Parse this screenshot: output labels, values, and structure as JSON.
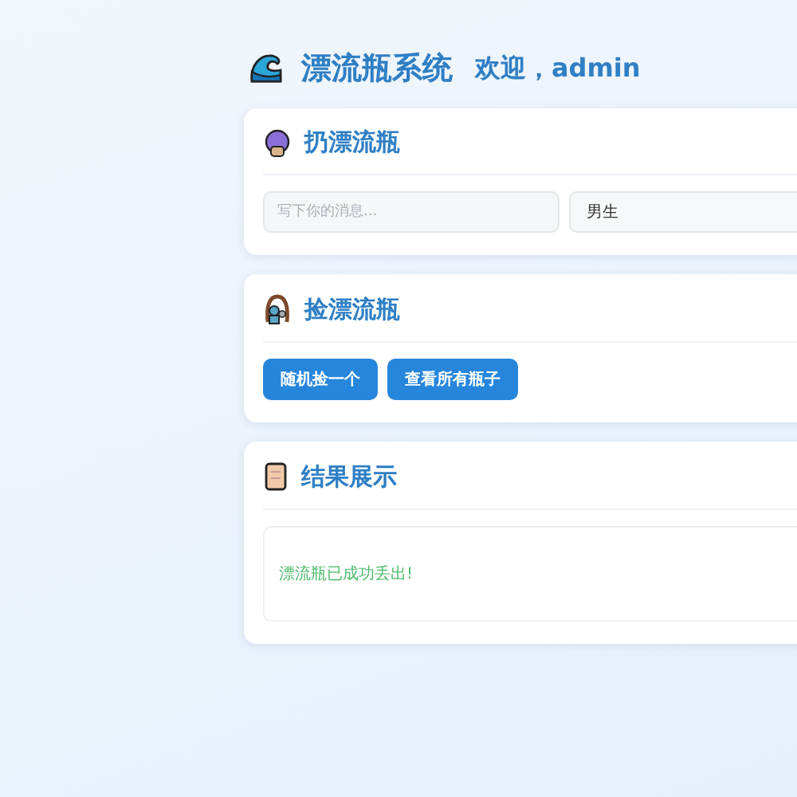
{
  "header": {
    "title": "漂流瓶系统",
    "welcome": "欢迎，admin"
  },
  "throw_section": {
    "title": "扔漂流瓶",
    "message": {
      "placeholder": "写下你的消息..."
    },
    "gender": {
      "value": "男生"
    }
  },
  "pick_section": {
    "title": "捡漂流瓶",
    "buttons": [
      "随机捡一个",
      "查看所有瓶子"
    ]
  },
  "result_section": {
    "title": "结果展示",
    "message": {
      "kind": "success",
      "text": "漂流瓶已成功丢出!"
    }
  }
}
